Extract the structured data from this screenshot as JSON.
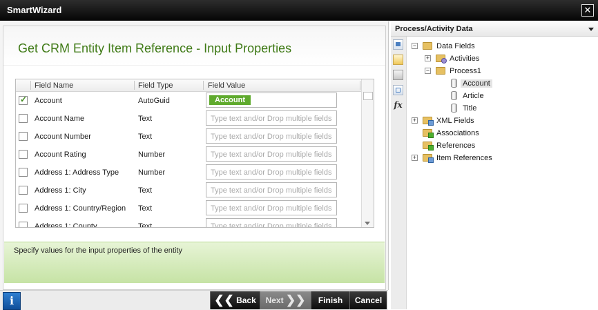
{
  "window": {
    "title": "SmartWizard",
    "close_glyph": "✕"
  },
  "page": {
    "title": "Get CRM Entity Item Reference - Input Properties",
    "description": "Specify values for the input properties of the entity"
  },
  "grid": {
    "columns": [
      "Field Name",
      "Field Type",
      "Field Value"
    ],
    "placeholder": "Type text and/or Drop multiple fields",
    "rows": [
      {
        "checked": true,
        "name": "Account",
        "type": "AutoGuid",
        "value": "Account"
      },
      {
        "checked": false,
        "name": "Account Name",
        "type": "Text",
        "value": ""
      },
      {
        "checked": false,
        "name": "Account Number",
        "type": "Text",
        "value": ""
      },
      {
        "checked": false,
        "name": "Account Rating",
        "type": "Number",
        "value": ""
      },
      {
        "checked": false,
        "name": "Address 1: Address Type",
        "type": "Number",
        "value": ""
      },
      {
        "checked": false,
        "name": "Address 1: City",
        "type": "Text",
        "value": ""
      },
      {
        "checked": false,
        "name": "Address 1: Country/Region",
        "type": "Text",
        "value": ""
      },
      {
        "checked": false,
        "name": "Address 1: County",
        "type": "Text",
        "value": ""
      }
    ]
  },
  "footer": {
    "info_glyph": "i",
    "back": "Back",
    "next": "Next",
    "finish": "Finish",
    "cancel": "Cancel"
  },
  "right_panel": {
    "title": "Process/Activity Data",
    "tree": {
      "data_fields": "Data Fields",
      "activities": "Activities",
      "process1": "Process1",
      "account": "Account",
      "article": "Article",
      "title_node": "Title",
      "xml_fields": "XML Fields",
      "associations": "Associations",
      "references": "References",
      "item_references": "Item References"
    },
    "tools": {
      "fx": "fx"
    }
  }
}
